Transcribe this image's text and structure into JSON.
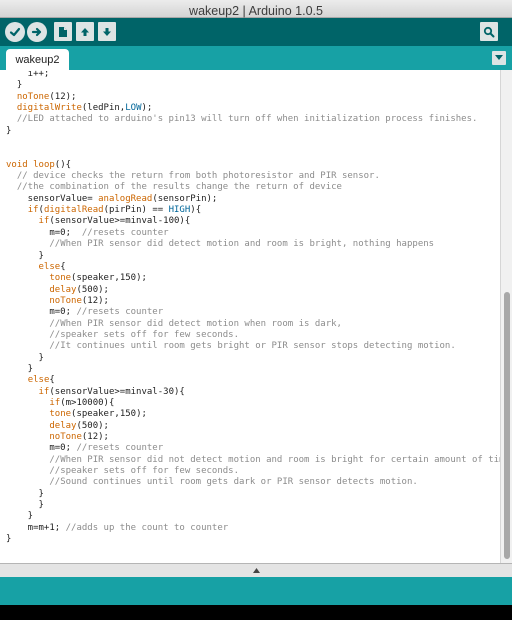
{
  "window": {
    "title": "wakeup2 | Arduino 1.0.5"
  },
  "toolbar": {
    "buttons": [
      {
        "name": "verify",
        "icon": "checkmark-icon"
      },
      {
        "name": "upload",
        "icon": "arrow-right-icon"
      },
      {
        "name": "new",
        "icon": "document-icon"
      },
      {
        "name": "open",
        "icon": "arrow-up-icon"
      },
      {
        "name": "save",
        "icon": "arrow-down-icon"
      },
      {
        "name": "serial-monitor",
        "icon": "magnifier-icon"
      }
    ]
  },
  "tabs": [
    {
      "label": "wakeup2",
      "active": true
    }
  ],
  "editor": {
    "code": [
      [
        [
          "    i++;"
        ]
      ],
      [
        [
          "  }"
        ]
      ],
      [
        [
          "  "
        ],
        [
          "noTone",
          "k"
        ],
        [
          "(12);"
        ]
      ],
      [
        [
          "  "
        ],
        [
          "digitalWrite",
          "k"
        ],
        [
          "(ledPin,"
        ],
        [
          "LOW",
          "b"
        ],
        [
          ");"
        ]
      ],
      [
        [
          "  "
        ],
        [
          "//LED attached to arduino's pin13 will turn off when initialization process finishes.",
          "c"
        ]
      ],
      [
        [
          "}"
        ]
      ],
      [
        [
          ""
        ]
      ],
      [
        [
          ""
        ]
      ],
      [
        [
          "void",
          "k"
        ],
        [
          " "
        ],
        [
          "loop",
          "k"
        ],
        [
          "(){"
        ]
      ],
      [
        [
          "  "
        ],
        [
          "// device checks the return from both photoresistor and PIR sensor.",
          "c"
        ]
      ],
      [
        [
          "  "
        ],
        [
          "//the combination of the results change the return of device",
          "c"
        ]
      ],
      [
        [
          "    sensorValue= "
        ],
        [
          "analogRead",
          "k"
        ],
        [
          "(sensorPin);"
        ]
      ],
      [
        [
          "    "
        ],
        [
          "if",
          "k"
        ],
        [
          "("
        ],
        [
          "digitalRead",
          "k"
        ],
        [
          "(pirPin) == "
        ],
        [
          "HIGH",
          "b"
        ],
        [
          "){"
        ]
      ],
      [
        [
          "      "
        ],
        [
          "if",
          "k"
        ],
        [
          "(sensorValue>=minval-100){"
        ]
      ],
      [
        [
          "        m=0;  "
        ],
        [
          "//resets counter",
          "c"
        ]
      ],
      [
        [
          "        "
        ],
        [
          "//When PIR sensor did detect motion and room is bright, nothing happens",
          "c"
        ]
      ],
      [
        [
          "      }"
        ]
      ],
      [
        [
          "      "
        ],
        [
          "else",
          "k"
        ],
        [
          "{"
        ]
      ],
      [
        [
          "        "
        ],
        [
          "tone",
          "k"
        ],
        [
          "(speaker,150);"
        ]
      ],
      [
        [
          "        "
        ],
        [
          "delay",
          "k"
        ],
        [
          "(500);"
        ]
      ],
      [
        [
          "        "
        ],
        [
          "noTone",
          "k"
        ],
        [
          "(12);"
        ]
      ],
      [
        [
          "        m=0; "
        ],
        [
          "//resets counter",
          "c"
        ]
      ],
      [
        [
          "        "
        ],
        [
          "//When PIR sensor did detect motion when room is dark,",
          "c"
        ]
      ],
      [
        [
          "        "
        ],
        [
          "//speaker sets off for few seconds.",
          "c"
        ]
      ],
      [
        [
          "        "
        ],
        [
          "//It continues until room gets bright or PIR sensor stops detecting motion.",
          "c"
        ]
      ],
      [
        [
          "      }"
        ]
      ],
      [
        [
          "    }"
        ]
      ],
      [
        [
          "    "
        ],
        [
          "else",
          "k"
        ],
        [
          "{"
        ]
      ],
      [
        [
          "      "
        ],
        [
          "if",
          "k"
        ],
        [
          "(sensorValue>=minval-30){"
        ]
      ],
      [
        [
          "        "
        ],
        [
          "if",
          "k"
        ],
        [
          "(m>10000){"
        ]
      ],
      [
        [
          "        "
        ],
        [
          "tone",
          "k"
        ],
        [
          "(speaker,150);"
        ]
      ],
      [
        [
          "        "
        ],
        [
          "delay",
          "k"
        ],
        [
          "(500);"
        ]
      ],
      [
        [
          "        "
        ],
        [
          "noTone",
          "k"
        ],
        [
          "(12);"
        ]
      ],
      [
        [
          "        m=0; "
        ],
        [
          "//resets counter",
          "c"
        ]
      ],
      [
        [
          "        "
        ],
        [
          "//When PIR sensor did not detect motion and room is bright for certain amount of time,",
          "c"
        ]
      ],
      [
        [
          "        "
        ],
        [
          "//speaker sets off for few seconds.",
          "c"
        ]
      ],
      [
        [
          "        "
        ],
        [
          "//Sound continues until room gets dark or PIR sensor detects motion.",
          "c"
        ]
      ],
      [
        [
          "      }"
        ]
      ],
      [
        [
          "      }"
        ]
      ],
      [
        [
          "    }"
        ]
      ],
      [
        [
          "    m=m+1; "
        ],
        [
          "//adds up the count to counter",
          "c"
        ]
      ],
      [
        [
          "}"
        ]
      ]
    ]
  },
  "colors": {
    "toolbar": "#006468",
    "tabbar": "#17a1a5",
    "keyword": "#cc6600",
    "constant": "#006699",
    "comment": "#8c8c8c"
  }
}
